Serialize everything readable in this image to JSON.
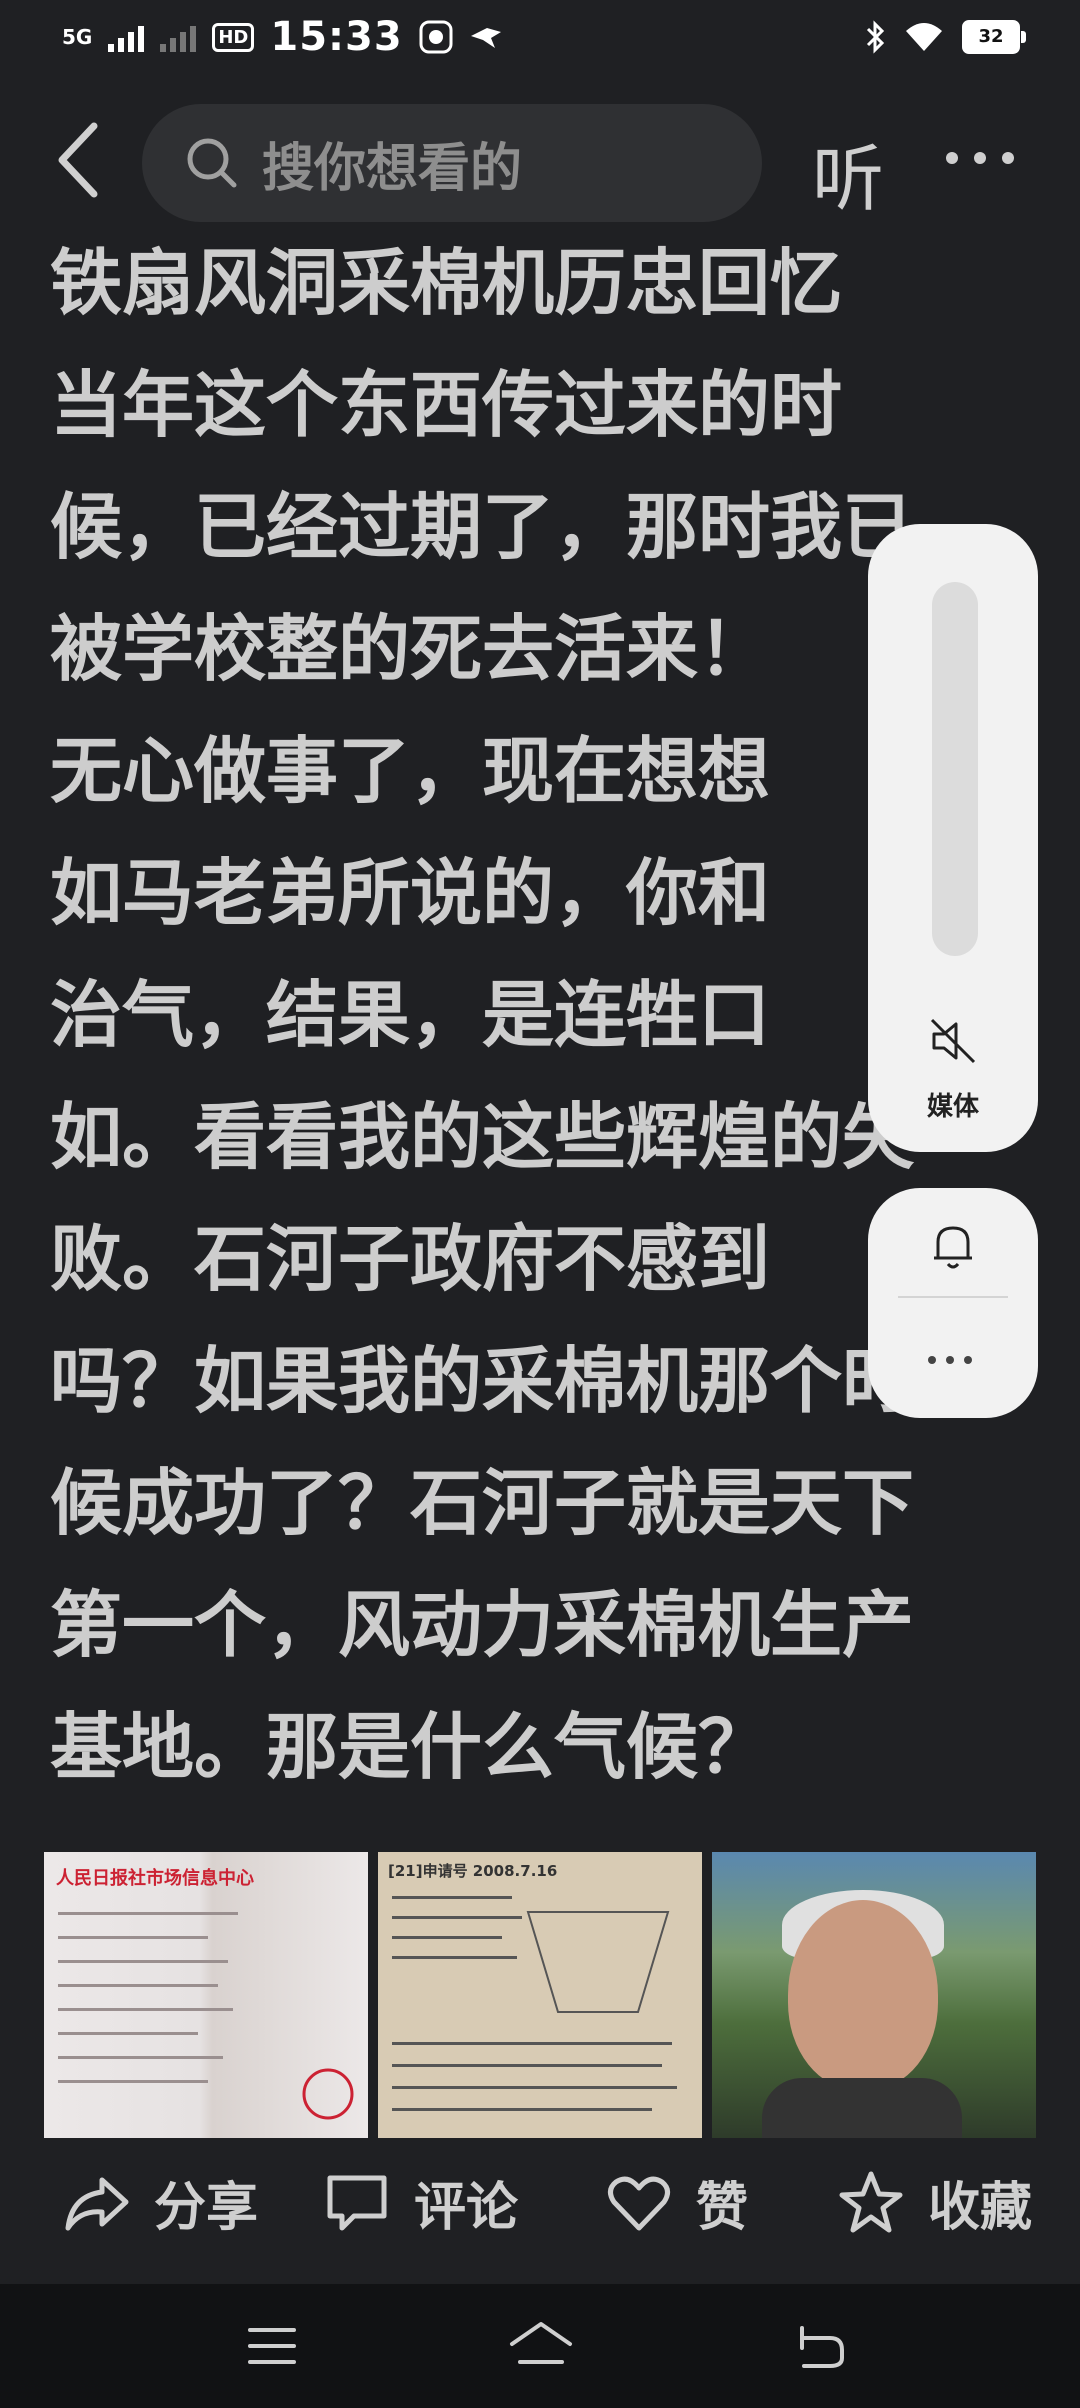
{
  "status_bar": {
    "network": "5G",
    "hd": "HD",
    "hd_sub": "1",
    "time": "15:33",
    "battery": "32"
  },
  "top_bar": {
    "search_placeholder": "搜你想看的",
    "listen_label": "听"
  },
  "article": {
    "text": "铁扇风洞采棉机历忠回忆\n当年这个东西传过来的时\n候，已经过期了，那时我已\n被学校整的死去活来！\n无心做事了，现在想想\n如马老弟所说的，你和\n治气，结果，是连牲口\n如。看看我的这些辉煌的失\n败。石河子政府不感到\n吗？如果我的采棉机那个时\n候成功了？石河子就是天下\n第一个，风动力采棉机生产\n基地。那是什么气候？"
  },
  "images": [
    {
      "alt": "document-photo",
      "caption": "人民日报社市场信息中心"
    },
    {
      "alt": "patent-document-photo",
      "caption": "[21]申请号 2008.7.16"
    },
    {
      "alt": "elderly-man-photo",
      "caption": ""
    }
  ],
  "actions": {
    "share": "分享",
    "comment": "评论",
    "like": "赞",
    "favorite": "收藏"
  },
  "volume_panel": {
    "media_label": "媒体"
  },
  "colors": {
    "background": "#1f2023",
    "text": "#cdcdcd",
    "panel": "#f2f2f2"
  }
}
